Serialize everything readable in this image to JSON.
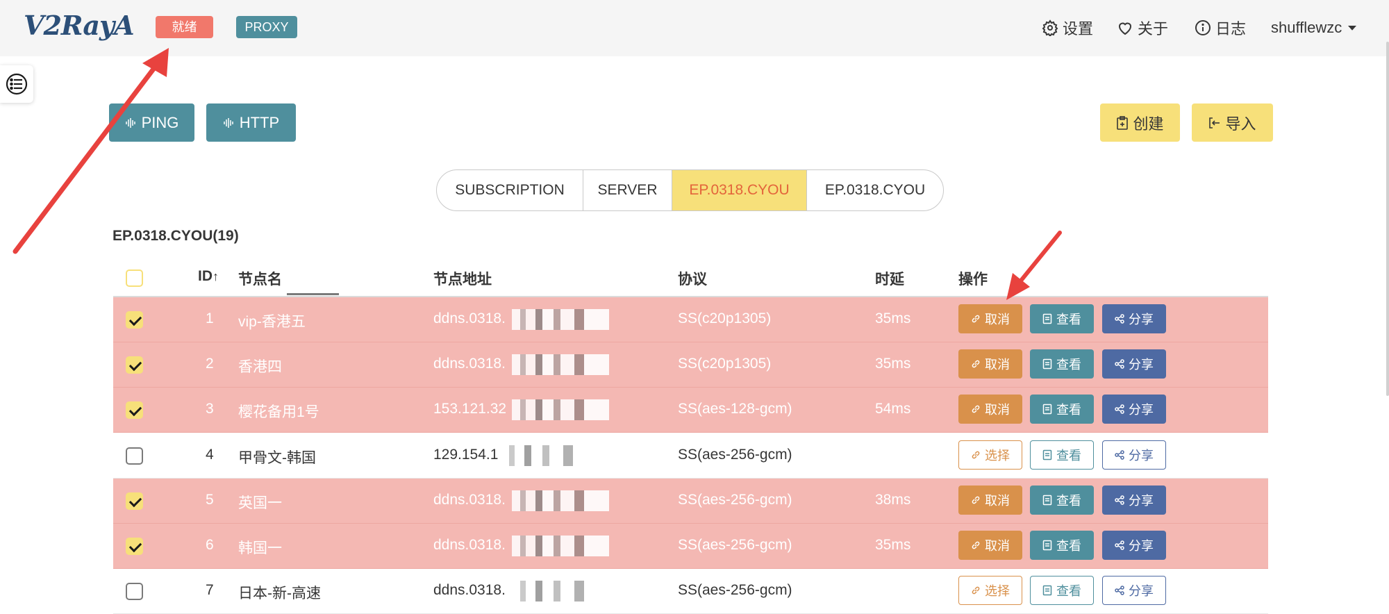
{
  "header": {
    "logo": "V2RayA",
    "status_tag": "就绪",
    "mode_tag": "PROXY",
    "nav": [
      {
        "label": "设置",
        "icon": "gear-icon"
      },
      {
        "label": "关于",
        "icon": "heart-icon"
      },
      {
        "label": "日志",
        "icon": "info-icon"
      }
    ],
    "user": "shufflewzc"
  },
  "toolbar": {
    "ping_label": "PING",
    "http_label": "HTTP",
    "create_label": "创建",
    "import_label": "导入"
  },
  "tabs": [
    {
      "label": "SUBSCRIPTION",
      "active": false
    },
    {
      "label": "SERVER",
      "active": false
    },
    {
      "label": "EP.0318.CYOU",
      "active": true
    },
    {
      "label": "EP.0318.CYOU",
      "active": false
    }
  ],
  "group_title": "EP.0318.CYOU(19)",
  "table": {
    "columns": {
      "id": "ID",
      "sort_arrow": "↑",
      "name": "节点名",
      "address": "节点地址",
      "protocol": "协议",
      "latency": "时延",
      "actions": "操作"
    },
    "rows": [
      {
        "id": "1",
        "name": "vip-香港五",
        "address": "ddns.0318.",
        "protocol": "SS(c20p1305)",
        "latency": "35ms",
        "selected": true,
        "action": "取消"
      },
      {
        "id": "2",
        "name": "香港四",
        "address": "ddns.0318.",
        "protocol": "SS(c20p1305)",
        "latency": "35ms",
        "selected": true,
        "action": "取消"
      },
      {
        "id": "3",
        "name": "樱花备用1号",
        "address": "153.121.32",
        "protocol": "SS(aes-128-gcm)",
        "latency": "54ms",
        "selected": true,
        "action": "取消"
      },
      {
        "id": "4",
        "name": "甲骨文-韩国",
        "address": "129.154.1",
        "protocol": "SS(aes-256-gcm)",
        "latency": "",
        "selected": false,
        "action": "选择"
      },
      {
        "id": "5",
        "name": "英国一",
        "address": "ddns.0318.",
        "protocol": "SS(aes-256-gcm)",
        "latency": "38ms",
        "selected": true,
        "action": "取消"
      },
      {
        "id": "6",
        "name": "韩国一",
        "address": "ddns.0318.",
        "protocol": "SS(aes-256-gcm)",
        "latency": "35ms",
        "selected": true,
        "action": "取消"
      },
      {
        "id": "7",
        "name": "日本-新-高速",
        "address": "ddns.0318.",
        "protocol": "SS(aes-256-gcm)",
        "latency": "",
        "selected": false,
        "action": "选择"
      }
    ],
    "view_label": "查看",
    "share_label": "分享"
  },
  "colors": {
    "selected_row": "#f4b8b3",
    "primary_teal": "#4f8f9d",
    "warning_yellow": "#f7e07a",
    "orange": "#d9914b",
    "link_blue": "#4e6aa3",
    "annotation_arrow": "#e8423e"
  }
}
